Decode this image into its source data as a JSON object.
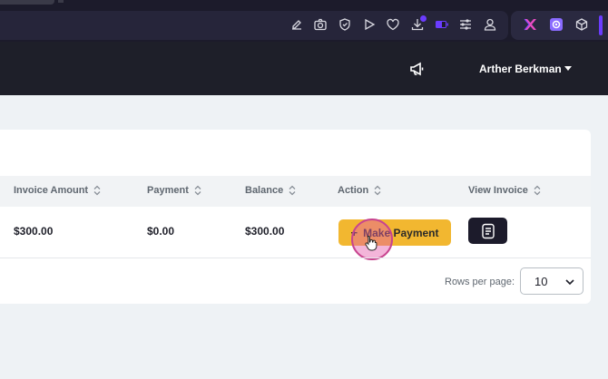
{
  "header": {
    "user_name": "Arther Berkman"
  },
  "toolbar_icons": [
    "edit-icon",
    "camera-icon",
    "shield-icon",
    "play-icon",
    "heart-icon",
    "download-icon",
    "battery-icon",
    "menu-icon",
    "user-icon",
    "puzzle-icon",
    "gear-icon",
    "cube-icon"
  ],
  "table": {
    "headers": [
      "Invoice Amount",
      "Payment",
      "Balance",
      "Action",
      "View Invoice"
    ],
    "row": {
      "invoice_amount": "$300.00",
      "payment": "$0.00",
      "balance": "$300.00",
      "action_label": "Make Payment"
    }
  },
  "pagination": {
    "rows_per_page_label": "Rows per page:",
    "rows_per_page_value": "10"
  },
  "colors": {
    "accent": "#f2b730",
    "dark": "#1e1f29",
    "highlight": "#e55aaa"
  }
}
